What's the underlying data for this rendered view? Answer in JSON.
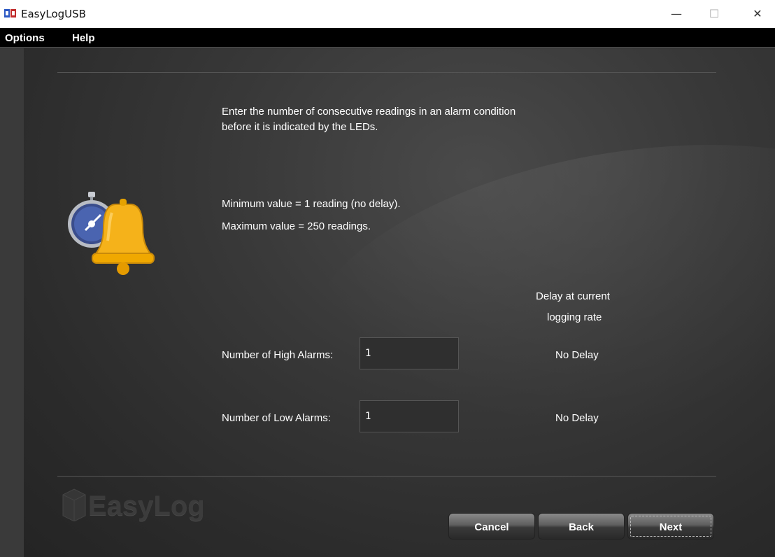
{
  "window": {
    "title": "EasyLogUSB",
    "controls": {
      "minimize": "—",
      "maximize": "☐",
      "close": "✕"
    }
  },
  "menu": {
    "items": [
      "Options",
      "Help"
    ]
  },
  "instructions": {
    "line1": "Enter the number of consecutive readings in an alarm condition",
    "line2": "before it is indicated by the LEDs."
  },
  "limits": {
    "min": "Minimum value = 1 reading (no delay).",
    "max": "Maximum value = 250 readings."
  },
  "delay_header": {
    "line1": "Delay at current",
    "line2": "logging rate"
  },
  "alarms": {
    "high": {
      "label": "Number of High Alarms:",
      "value": "1",
      "delay": "No Delay"
    },
    "low": {
      "label": "Number of Low Alarms:",
      "value": "1",
      "delay": "No Delay"
    }
  },
  "brand": {
    "logo_text": "EasyLog"
  },
  "buttons": {
    "cancel": "Cancel",
    "back": "Back",
    "next": "Next"
  },
  "icons": [
    "app-icon",
    "stopwatch-bell-icon",
    "easylog-logo-icon"
  ],
  "colors": {
    "background": "#2a2a2a",
    "menubar": "#000000",
    "bell": "#f5b21a"
  }
}
